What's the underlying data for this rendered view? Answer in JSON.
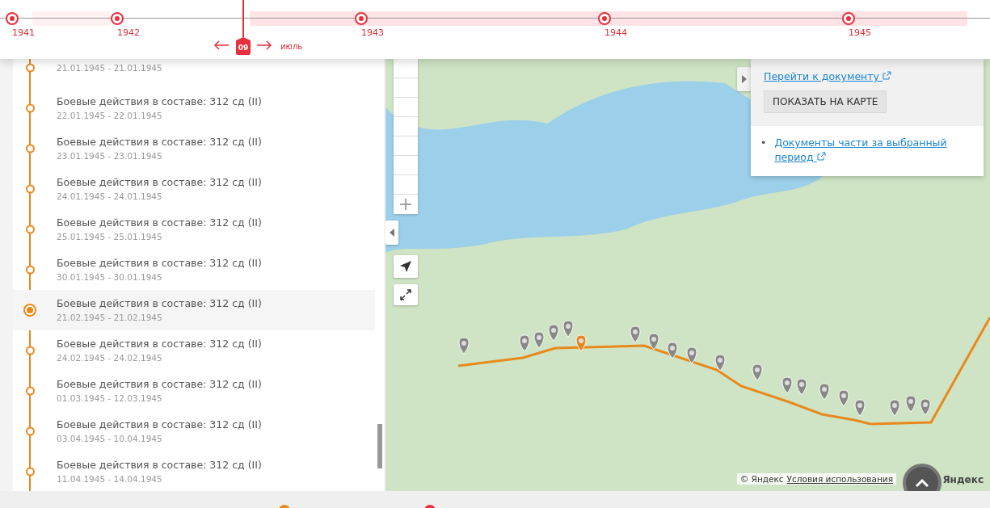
{
  "timeline": {
    "years": [
      {
        "label": "1941"
      },
      {
        "label": "1942"
      },
      {
        "label": "1943"
      },
      {
        "label": "1944"
      },
      {
        "label": "1945"
      }
    ],
    "current": {
      "day": "09",
      "month": "июль"
    }
  },
  "events": [
    {
      "dates": "21.01.1945 - 21.01.1945",
      "selected": false
    },
    {
      "title": "Боевые действия в составе: 312 сд (II)",
      "dates": "22.01.1945 - 22.01.1945",
      "selected": false
    },
    {
      "title": "Боевые действия в составе: 312 сд (II)",
      "dates": "23.01.1945 - 23.01.1945",
      "selected": false
    },
    {
      "title": "Боевые действия в составе: 312 сд (II)",
      "dates": "24.01.1945 - 24.01.1945",
      "selected": false
    },
    {
      "title": "Боевые действия в составе: 312 сд (II)",
      "dates": "25.01.1945 - 25.01.1945",
      "selected": false
    },
    {
      "title": "Боевые действия в составе: 312 сд (II)",
      "dates": "30.01.1945 - 30.01.1945",
      "selected": false
    },
    {
      "title": "Боевые действия в составе: 312 сд (II)",
      "dates": "21.02.1945 - 21.02.1945",
      "selected": true
    },
    {
      "title": "Боевые действия в составе: 312 сд (II)",
      "dates": "24.02.1945 - 24.02.1945",
      "selected": false
    },
    {
      "title": "Боевые действия в составе: 312 сд (II)",
      "dates": "01.03.1945 - 12.03.1945",
      "selected": false
    },
    {
      "title": "Боевые действия в составе: 312 сд (II)",
      "dates": "03.04.1945 - 10.04.1945",
      "selected": false
    },
    {
      "title": "Боевые действия в составе: 312 сд (II)",
      "dates": "11.04.1945 - 14.04.1945",
      "selected": false
    }
  ],
  "info_panel": {
    "document_link": "Перейти к документу",
    "show_button": "ПОКАЗАТЬ НА КАРТЕ",
    "links": [
      {
        "bullet": "•",
        "label": "Документы части за выбранный период"
      }
    ]
  },
  "map": {
    "attribution": "© Яндекс",
    "terms_link": "Условия использования",
    "logo": "Яндекс"
  }
}
